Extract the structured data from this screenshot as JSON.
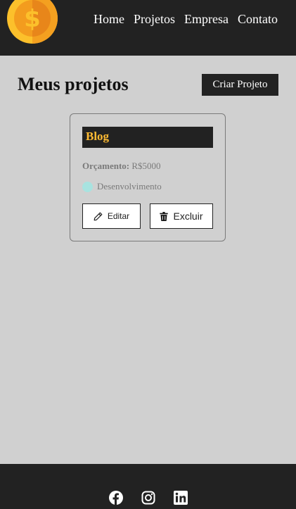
{
  "nav": {
    "links": [
      "Home",
      "Projetos",
      "Empresa",
      "Contato"
    ],
    "logo_icon": "coin-dollar-icon"
  },
  "page": {
    "title": "Meus projetos",
    "create_button": "Criar Projeto"
  },
  "projects": [
    {
      "name": "Blog",
      "budget_label": "Orçamento:",
      "budget_value": "R$5000",
      "category": "Desenvolvimento",
      "category_color": "#a8e3e0",
      "edit_label": "Editar",
      "delete_label": "Excluir"
    }
  ],
  "footer": {
    "social_icons": [
      "facebook-icon",
      "instagram-icon",
      "linkedin-icon"
    ]
  },
  "colors": {
    "dark": "#222222",
    "accent": "#ffbb33",
    "background": "#d0d0d0"
  }
}
